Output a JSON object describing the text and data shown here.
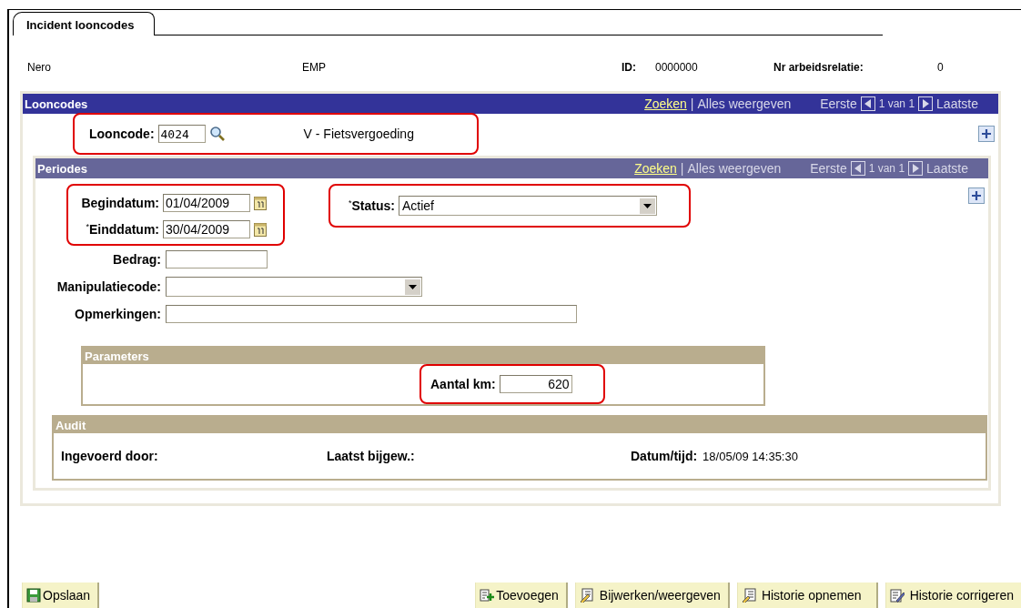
{
  "tab": {
    "label": "Incident looncodes",
    "selected": true
  },
  "header": {
    "name": "Nero",
    "type": "EMP",
    "id_label": "ID:",
    "id": "0000000",
    "relation_label": "Nr arbeidsrelatie:",
    "relation": "0"
  },
  "looncodes": {
    "title": "Looncodes",
    "nav": {
      "search": "Zoeken",
      "separator": "|",
      "show_all": "Alles weergeven",
      "first": "Eerste",
      "count": "1 van 1",
      "last": "Laatste"
    },
    "field": {
      "label": "Looncode:",
      "value": "4024",
      "highlighted": true
    },
    "description": "V - Fietsvergoeding",
    "periodes": {
      "title": "Periodes",
      "nav": {
        "search": "Zoeken",
        "separator": "|",
        "show_all": "Alles weergeven",
        "first": "Eerste",
        "count": "1 van 1",
        "last": "Laatste"
      },
      "dates": {
        "highlighted": true,
        "fields": [
          {
            "label": "Begindatum:",
            "value": "01/04/2009"
          },
          {
            "label": "Einddatum:",
            "required_mark": "*",
            "value": "30/04/2009"
          }
        ]
      },
      "status": {
        "label": "Status:",
        "required_mark": "*",
        "value": "Actief",
        "highlighted": true
      },
      "fields": [
        {
          "kind": "input",
          "label": "Bedrag:"
        },
        {
          "kind": "select",
          "label": "Manipulatiecode:"
        },
        {
          "kind": "wide",
          "label": "Opmerkingen:"
        }
      ],
      "parameters": {
        "title": "Parameters",
        "field": {
          "label": "Aantal km:",
          "value": "620",
          "highlighted": true
        }
      },
      "audit": {
        "title": "Audit",
        "items": [
          {
            "label": "Ingevoerd door:"
          },
          {
            "label": "Laatst bijgew.:"
          },
          {
            "label": "Datum/tijd:",
            "value": "18/05/09 14:35:30"
          }
        ]
      }
    }
  },
  "buttons": [
    {
      "kind": "save",
      "label": "Opslaan"
    },
    {
      "kind": "add",
      "label": "Toevoegen"
    },
    {
      "kind": "update",
      "label": "Bijwerken/weergeven"
    },
    {
      "kind": "history",
      "label": "Historie opnemen"
    },
    {
      "kind": "correct",
      "label": "Historie corrigeren"
    }
  ]
}
